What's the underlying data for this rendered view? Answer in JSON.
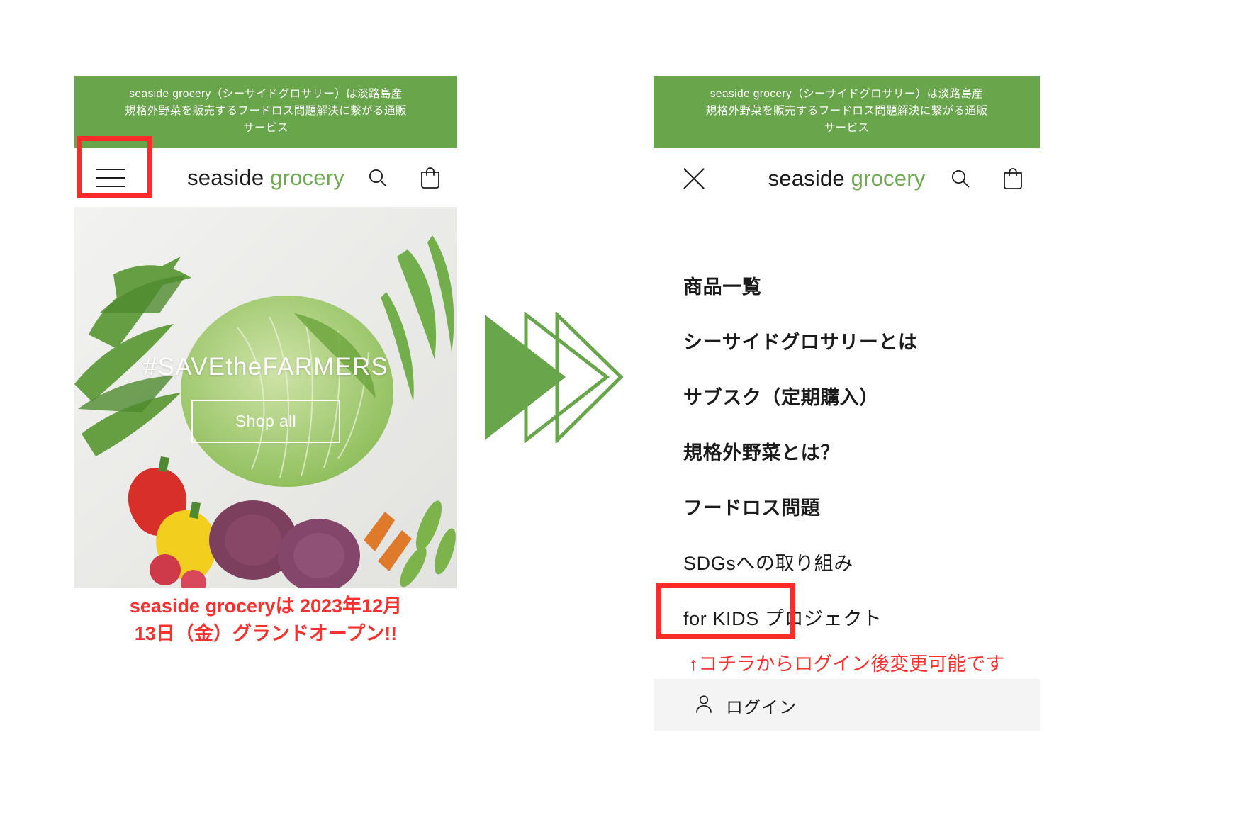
{
  "announcement": {
    "line1": "seaside grocery（シーサイドグロサリー）は淡路島産",
    "line2": "規格外野菜を販売するフードロス問題解決に繋がる通販",
    "line3": "サービス",
    "bg_color": "#68a54b",
    "text_color": "#ffffff"
  },
  "brand": {
    "word1": "seaside",
    "word2": "grocery",
    "word1_color": "#1b1b1b",
    "word2_color": "#6faa52"
  },
  "left_panel": {
    "menu_icon": "hamburger-icon",
    "search_icon": "search-icon",
    "cart_icon": "cart-icon",
    "hero": {
      "title": "#SAVEtheFARMERS",
      "cta_label": "Shop all",
      "alt": "assorted fresh vegetables on white background"
    },
    "annotation": {
      "line1": "seaside groceryは 2023年12月",
      "line2": "13日（金）グランドオープン!!",
      "color": "#f8312f"
    },
    "highlight_target": "hamburger-menu-button"
  },
  "transition": {
    "icon": "double-chevron-right-icon",
    "color": "#68a54b"
  },
  "right_panel": {
    "close_icon": "close-icon",
    "search_icon": "search-icon",
    "cart_icon": "cart-icon",
    "menu_items": [
      {
        "label": "商品一覧",
        "name": "menu-item-products",
        "latin": false
      },
      {
        "label": "シーサイドグロサリーとは",
        "name": "menu-item-about",
        "latin": false
      },
      {
        "label": "サブスク（定期購入）",
        "name": "menu-item-subscription",
        "latin": false
      },
      {
        "label": "規格外野菜とは？",
        "name": "menu-item-nonstandard-vegetables",
        "latin": false
      },
      {
        "label": "フードロス問題",
        "name": "menu-item-food-loss",
        "latin": false
      },
      {
        "label": "SDGsへの取り組み",
        "name": "menu-item-sdgs",
        "latin": true
      },
      {
        "label": "for KIDS プロジェクト",
        "name": "menu-item-for-kids",
        "latin": true
      }
    ],
    "login": {
      "label": "ログイン",
      "icon": "user-icon",
      "bg_color": "#f4f4f4"
    },
    "annotation": {
      "text": "↑コチラからログイン後変更可能です",
      "color": "#f8312f"
    },
    "highlight_target": "login-button"
  }
}
